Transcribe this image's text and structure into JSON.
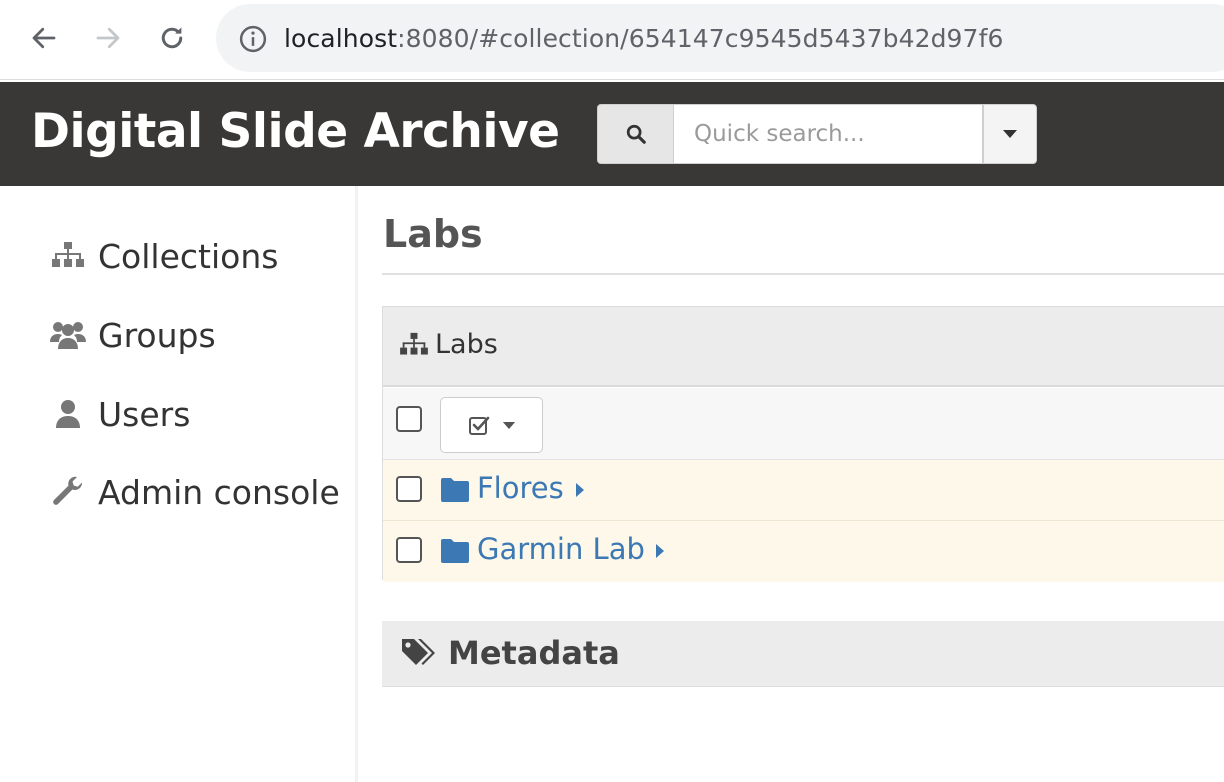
{
  "browser": {
    "url_host": "localhost",
    "url_path": ":8080/#collection/654147c9545d5437b42d97f6"
  },
  "header": {
    "title": "Digital Slide Archive",
    "search_placeholder": "Quick search..."
  },
  "sidebar": {
    "items": [
      {
        "label": "Collections",
        "icon": "sitemap-icon"
      },
      {
        "label": "Groups",
        "icon": "users-icon"
      },
      {
        "label": "Users",
        "icon": "user-icon"
      },
      {
        "label": "Admin console",
        "icon": "wrench-icon"
      }
    ]
  },
  "main": {
    "page_title": "Labs",
    "breadcrumb": "Labs",
    "folders": [
      {
        "name": "Flores"
      },
      {
        "name": "Garmin Lab"
      }
    ],
    "metadata_title": "Metadata"
  },
  "colors": {
    "header_bg": "#3a3836",
    "link": "#3b78b4",
    "folder_row_bg": "#fdf8ea"
  }
}
